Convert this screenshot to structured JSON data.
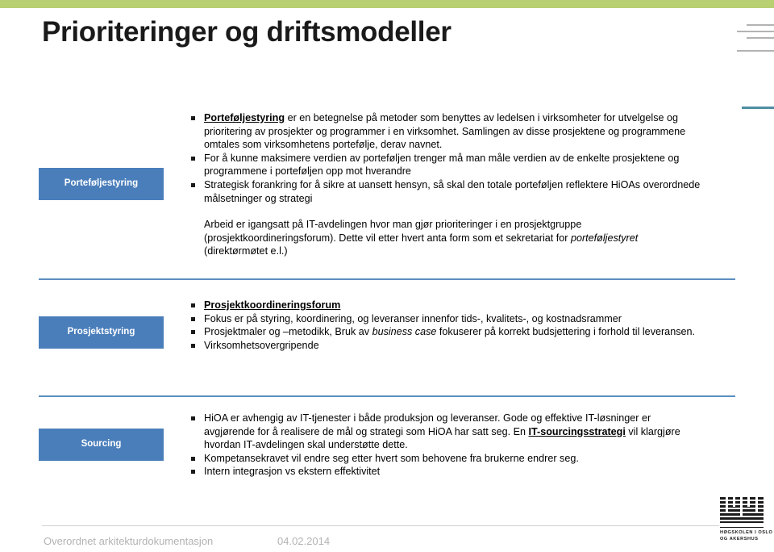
{
  "slide": {
    "title": "Prioriteringer og driftsmodeller",
    "accent_green": "#b8cf72",
    "accent_blue": "#4a7ebb",
    "separator_blue": "#5a8fc0"
  },
  "sections": [
    {
      "badge": "Porteføljestyring",
      "bullets": [
        {
          "runs": [
            {
              "text": "Porteføljestyring",
              "style": "bold-underline"
            },
            {
              "text": " er en betegnelse på metoder som benyttes av ledelsen i virksomheter for utvelgelse og prioritering av prosjekter og programmer i en virksomhet. Samlingen av disse prosjektene og programmene omtales som virksomhetens portefølje, derav navnet.",
              "style": "normal"
            }
          ]
        },
        {
          "runs": [
            {
              "text": "For å kunne maksimere verdien av porteføljen trenger må man måle verdien av de enkelte prosjektene og programmene i porteføljen opp mot hverandre",
              "style": "normal"
            }
          ]
        },
        {
          "runs": [
            {
              "text": "Strategisk forankring for å sikre at uansett hensyn, så skal den totale porteføljen reflektere HiOAs overordnede målsetninger og strategi",
              "style": "normal"
            }
          ]
        }
      ],
      "paragraph_runs": [
        {
          "text": "Arbeid er igangsatt på IT-avdelingen hvor man gjør prioriteringer i en prosjektgruppe (prosjektkoordineringsforum). Dette vil etter hvert anta form som et sekretariat for ",
          "style": "normal"
        },
        {
          "text": "porteføljestyret",
          "style": "italic"
        },
        {
          "text": " (direktørmøtet e.l.)",
          "style": "normal"
        }
      ]
    },
    {
      "badge": "Prosjektstyring",
      "bullets": [
        {
          "runs": [
            {
              "text": "Prosjektkoordineringsforum",
              "style": "bold-underline"
            }
          ]
        },
        {
          "runs": [
            {
              "text": "Fokus er på styring, koordinering, og leveranser innenfor tids-, kvalitets-, og kostnadsrammer",
              "style": "normal"
            }
          ]
        },
        {
          "runs": [
            {
              "text": "Prosjektmaler og –metodikk, Bruk av ",
              "style": "normal"
            },
            {
              "text": "business case",
              "style": "italic"
            },
            {
              "text": " fokuserer på korrekt budsjettering i forhold til leveransen.",
              "style": "normal"
            }
          ]
        },
        {
          "runs": [
            {
              "text": "Virksomhetsovergripende",
              "style": "normal"
            }
          ]
        }
      ]
    },
    {
      "badge": "Sourcing",
      "bullets": [
        {
          "runs": [
            {
              "text": "HiOA er avhengig av IT-tjenester i både produksjon og leveranser. Gode og effektive IT-løsninger er avgjørende for å realisere de mål og strategi som HiOA har satt seg. En ",
              "style": "normal"
            },
            {
              "text": "IT-sourcingsstrategi",
              "style": "bold-underline"
            },
            {
              "text": " vil klargjøre hvordan IT-avdelingen skal understøtte dette.",
              "style": "normal"
            }
          ]
        },
        {
          "runs": [
            {
              "text": "Kompetansekravet vil endre seg etter hvert som behovene fra brukerne endrer seg.",
              "style": "normal"
            }
          ]
        },
        {
          "runs": [
            {
              "text": "Intern integrasjon vs ekstern effektivitet",
              "style": "normal"
            }
          ]
        }
      ]
    }
  ],
  "footer": {
    "left": "Overordnet arkitekturdokumentasjon",
    "date": "04.02.2014"
  },
  "logo": {
    "line1": "HØGSKOLEN I OSLO",
    "line2": "OG AKERSHUS"
  }
}
